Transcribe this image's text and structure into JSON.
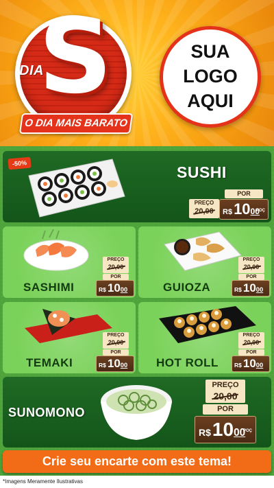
{
  "header": {
    "brand_small": "DIA",
    "brand_letter": "S",
    "brand_ribbon": "O DIA MAIS BARATO",
    "logo_placeholder": [
      "SUA",
      "LOGO",
      "AQUI"
    ]
  },
  "products": [
    {
      "name": "SUSHI",
      "badge": "-50%",
      "from_label": "PREÇO",
      "old_price": "20,00",
      "to_label": "POR",
      "currency": "R$",
      "price_int": "10",
      "price_dec": "00",
      "unit": "POÇ"
    },
    {
      "name": "SASHIMI",
      "from_label": "PREÇO",
      "old_price": "20,00",
      "to_label": "POR",
      "currency": "R$",
      "price_int": "10",
      "price_dec": "00",
      "unit": "POÇ"
    },
    {
      "name": "GUIOZA",
      "from_label": "PREÇO",
      "old_price": "20,00",
      "to_label": "POR",
      "currency": "R$",
      "price_int": "10",
      "price_dec": "00",
      "unit": "POÇ"
    },
    {
      "name": "TEMAKI",
      "from_label": "PREÇO",
      "old_price": "20,00",
      "to_label": "POR",
      "currency": "R$",
      "price_int": "10",
      "price_dec": "00",
      "unit": "POÇ"
    },
    {
      "name": "HOT ROLL",
      "from_label": "PREÇO",
      "old_price": "20,00",
      "to_label": "POR",
      "currency": "R$",
      "price_int": "10",
      "price_dec": "00",
      "unit": "POÇ"
    },
    {
      "name": "SUNOMONO",
      "from_label": "PREÇO",
      "old_price": "20,00",
      "to_label": "POR",
      "currency": "R$",
      "price_int": "10",
      "price_dec": "00",
      "unit": "POÇ"
    }
  ],
  "cta": "Crie seu encarte com este tema!",
  "footnote": "*Imagens Meramente Ilustrativas",
  "colors": {
    "accent": "#e4321b",
    "green_dark": "#1f6a24",
    "green_light": "#7bd25a",
    "orange": "#f26b16",
    "wood": "#5a3418"
  }
}
